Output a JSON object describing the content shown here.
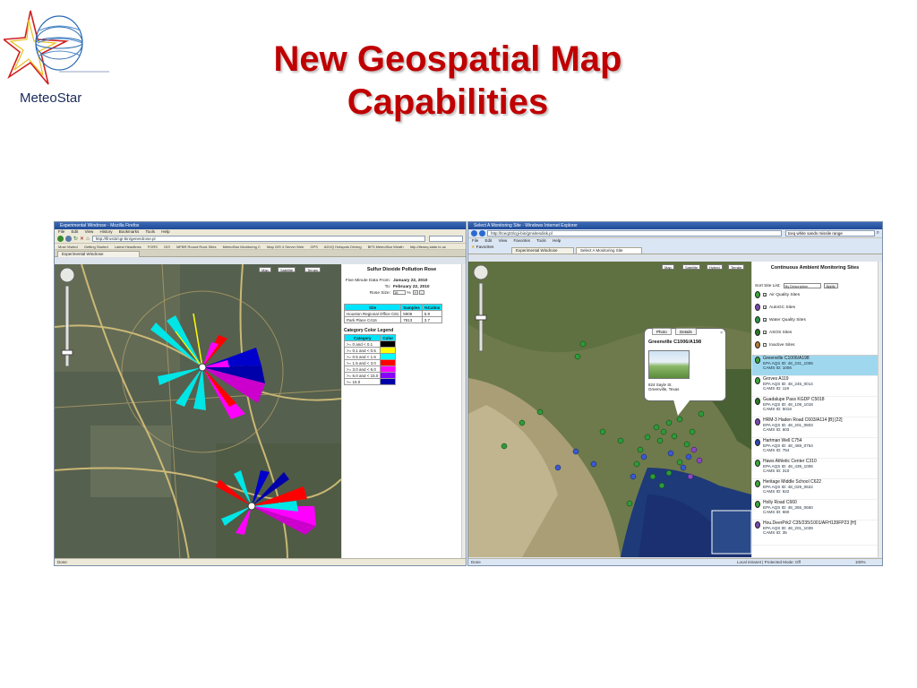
{
  "slide": {
    "logo_text": "MeteoStar",
    "title_line1": "New Geospatial Map",
    "title_line2": "Capabilities"
  },
  "left_browser": {
    "window_title": "Experimental Windrose - Mozilla Firefox",
    "menu": [
      "File",
      "Edit",
      "View",
      "History",
      "Bookmarks",
      "Tools",
      "Help"
    ],
    "url": "http://lfrost3/cgi-bin/generdrose.pl",
    "bookmarks": [
      "Most Visited",
      "Getting Started",
      "Latest Headlines",
      "FORS",
      "GIS",
      "MFBR Round Rock Sites",
      "MeteoStar Monitoring C",
      "Map GIS 4 Server Web",
      "GPS",
      "ADVQ Hotspots Driving",
      "BFS MeteoStar Weath",
      "http://lteseq.state.tx.us"
    ],
    "tab": "Experimental Windrose",
    "status": "Done",
    "map_types": [
      "Map",
      "Satellite",
      "Terrain"
    ],
    "panel": {
      "title": "Sulfur Dioxide Pollution Rose",
      "from_label": "Five Minute Data From:",
      "from_value": "January 22, 2010",
      "to_label": "To:",
      "to_value": "February 22, 2010",
      "rose_size_label": "Rose Size:",
      "rose_size_value": "16",
      "rose_size_unit": "%",
      "plus": "+",
      "minus": "-",
      "sites_headers": [
        "Site",
        "Samples",
        "%Calms"
      ],
      "sites_rows": [
        [
          "Houston Regional Office C81",
          "5906",
          "5.9"
        ],
        [
          "Park Place C416",
          "7813",
          "3.7"
        ]
      ],
      "legend_title": "Category Color Legend",
      "legend_headers": [
        "Category",
        "Color"
      ],
      "legend_rows": [
        {
          "label": ">= 0 and < 0.1",
          "color": "#000000"
        },
        {
          "label": ">= 0.1 and < 0.5",
          "color": "#ffff00"
        },
        {
          "label": ">= 0.5 and < 1.5",
          "color": "#00ffff"
        },
        {
          "label": ">= 1.5 and < 3.0",
          "color": "#ff0000"
        },
        {
          "label": ">= 3.0 and < 6.0",
          "color": "#ff00ff"
        },
        {
          "label": ">= 6.0 and < 15.0",
          "color": "#8800ff"
        },
        {
          "label": ">= 15.0",
          "color": "#0000aa"
        }
      ]
    }
  },
  "right_browser": {
    "window_title": "Select A Monitoring Site - Windows Internet Explorer",
    "url": "http://tceq23/cgi-bin/gmsitesdisk.pl",
    "search_text": "tceq white sands missile range",
    "menu": [
      "File",
      "Edit",
      "View",
      "Favorites",
      "Tools",
      "Help"
    ],
    "favorites_label": "Favorites",
    "tabs": [
      "Experimental Windrose",
      "Select A Monitoring Site"
    ],
    "status": "Done",
    "status_zone": "Local intranet | Protected Mode: Off",
    "zoom": "100%",
    "map_types": [
      "Map",
      "Satellite",
      "Hybrid",
      "Terrain"
    ],
    "popup": {
      "tabs": [
        "Photo",
        "Details"
      ],
      "title": "Greenville C1006/A198",
      "address_line1": "824 Sayle St.",
      "address_line2": "Greenville, Texas",
      "close": "×"
    },
    "panel": {
      "title": "Continuous Ambient Monitoring Sites",
      "sort_label": "Sort Site List:",
      "sort_value": "By Description",
      "apply": "Apply",
      "filters": [
        {
          "label": "Air Quality Sites",
          "checked": true,
          "color": "#3aa83a"
        },
        {
          "label": "AutoGC Sites",
          "checked": true,
          "color": "#7a4ab0"
        },
        {
          "label": "Water Quality Sites",
          "checked": true,
          "color": "#2a9a4a"
        },
        {
          "label": "ASOS Sites",
          "checked": true,
          "color": "#2a7a2a"
        },
        {
          "label": "Inactive Sites",
          "checked": false,
          "color": "#b07a3a"
        }
      ],
      "sites": [
        {
          "name": "Greenville C1006/A198",
          "epa": "EPA AQS ID: 48_231_1006",
          "cams": "CAMS ID: 1006",
          "color": "#3aa83a",
          "selected": true
        },
        {
          "name": "Groves A119",
          "epa": "EPA AQS ID: 48_245_0014",
          "cams": "CAMS ID: 119",
          "color": "#3aa83a",
          "selected": false
        },
        {
          "name": "Guadalupe Pass KGDP C5018",
          "epa": "EPA AQS ID: 48_109_1018",
          "cams": "CAMS ID: 5018",
          "color": "#2a7a2a",
          "selected": false
        },
        {
          "name": "HRM-3 Haden Road C603/A114 [B] [22]",
          "epa": "EPA AQS ID: 48_201_0803",
          "cams": "CAMS ID: 603",
          "color": "#7a4ab0",
          "selected": false
        },
        {
          "name": "Hartman Well C754",
          "epa": "EPA AQS ID: 48_469_0754",
          "cams": "CAMS ID: 754",
          "color": "#2a4ab0",
          "selected": false
        },
        {
          "name": "Haws Athletic Center C310",
          "epa": "EPA AQS ID: 48_439_1006",
          "cams": "CAMS ID: 310",
          "color": "#3aa83a",
          "selected": false
        },
        {
          "name": "Heritage Middle School C622",
          "epa": "EPA AQS ID: 48_029_0622",
          "cams": "CAMS ID: 622",
          "color": "#3aa83a",
          "selected": false
        },
        {
          "name": "Holly Road C660",
          "epa": "EPA AQS ID: 48_355_0660",
          "cams": "CAMS ID: 660",
          "color": "#3aa83a",
          "selected": false
        },
        {
          "name": "Hou.DeerPrk2 C35/235/1001/AFH139FP23 [H]",
          "epa": "EPA AQS ID: 48_201_1039",
          "cams": "CAMS ID: 35",
          "color": "#7a4ab0",
          "selected": false
        }
      ]
    }
  }
}
